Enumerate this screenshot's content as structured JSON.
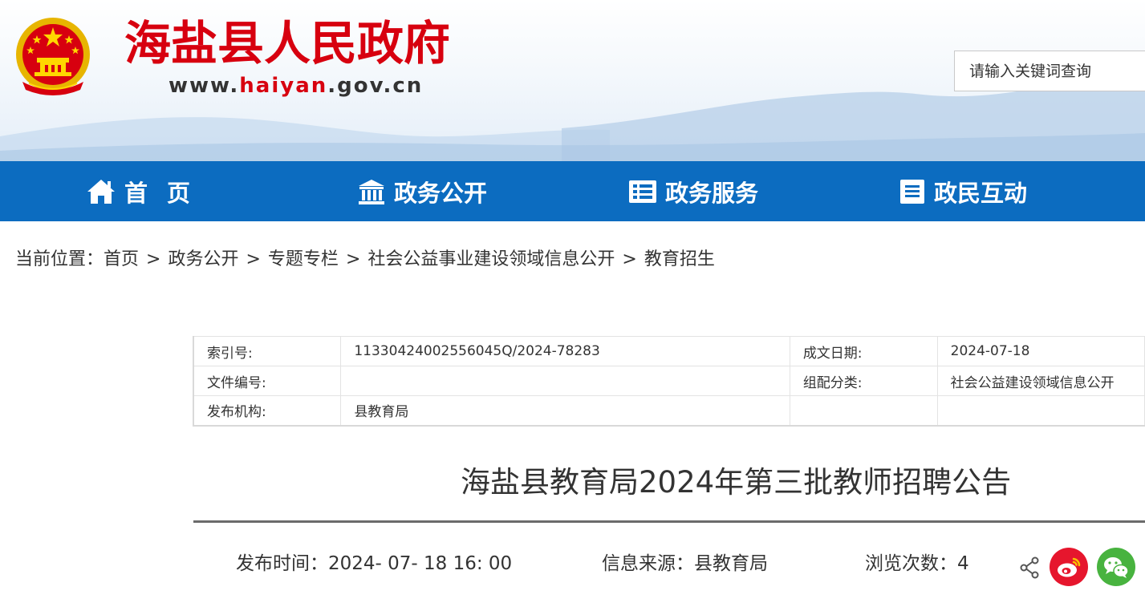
{
  "header": {
    "site_title": "海盐县人民政府",
    "site_url_prefix": "www.",
    "site_url_highlight": "haiyan",
    "site_url_suffix": ".gov.cn",
    "search_placeholder": "请输入关键词查询",
    "brand_red": "#d7000f"
  },
  "nav": {
    "bg_color": "#0c6cc0",
    "items": [
      {
        "label": "首页",
        "icon": "home-icon"
      },
      {
        "label": "政务公开",
        "icon": "bank-icon"
      },
      {
        "label": "政务服务",
        "icon": "document-list-icon"
      },
      {
        "label": "政民互动",
        "icon": "list-icon"
      }
    ]
  },
  "breadcrumb": {
    "prefix": "当前位置：",
    "items": [
      "首页",
      "政务公开",
      "专题专栏",
      "社会公益事业建设领域信息公开",
      "教育招生"
    ],
    "separator": ">"
  },
  "meta": {
    "index_label": "索引号:",
    "index_value": "11330424002556045Q/2024-78283",
    "date_label": "成文日期:",
    "date_value": "2024-07-18",
    "doc_no_label": "文件编号:",
    "doc_no_value": "",
    "category_label": "组配分类:",
    "category_value": "社会公益建设领域信息公开",
    "publisher_label": "发布机构:",
    "publisher_value": "县教育局"
  },
  "article": {
    "title": "海盐县教育局2024年第三批教师招聘公告",
    "publish_time_label": "发布时间：",
    "publish_time": "2024- 07- 18 16: 00",
    "source_label": "信息来源：",
    "source": "县教育局",
    "views_label": "浏览次数：",
    "views": "4"
  },
  "share": {
    "icons": [
      "share-icon",
      "weibo-icon",
      "wechat-icon"
    ],
    "weibo_color": "#e6162d",
    "wechat_color": "#48b33f"
  }
}
